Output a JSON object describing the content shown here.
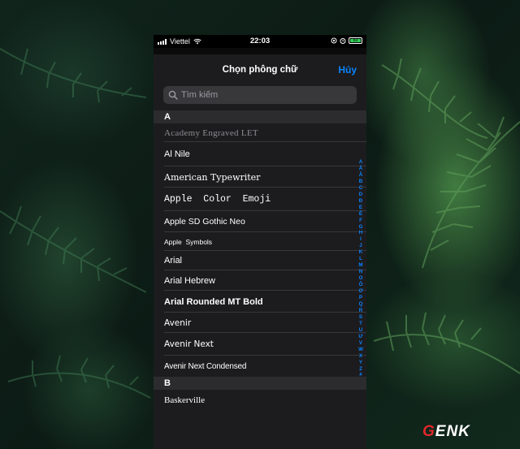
{
  "status_bar": {
    "carrier": "Viettel",
    "time": "22:03",
    "battery": "83"
  },
  "sheet": {
    "title": "Chọn phông chữ",
    "cancel_label": "Hủy",
    "search_placeholder": "Tìm kiếm",
    "sections": [
      {
        "letter": "A",
        "fonts": [
          "Academy Engraved LET",
          "Al Nile",
          "American Typewriter",
          "Apple  Color  Emoji",
          "Apple SD Gothic Neo",
          "Apple  Symbols",
          "Arial",
          "Arial Hebrew",
          "Arial Rounded MT Bold",
          "Avenir",
          "Avenir Next",
          "Avenir Next Condensed"
        ]
      },
      {
        "letter": "B",
        "fonts": [
          "Baskerville"
        ]
      }
    ]
  },
  "index_letters": [
    "A",
    "Ă",
    "Â",
    "B",
    "C",
    "D",
    "Đ",
    "E",
    "Ê",
    "F",
    "G",
    "H",
    "I",
    "J",
    "K",
    "L",
    "M",
    "N",
    "O",
    "Ô",
    "Ơ",
    "P",
    "Q",
    "R",
    "S",
    "T",
    "U",
    "Ư",
    "V",
    "W",
    "X",
    "Y",
    "Z",
    "#"
  ],
  "watermark": {
    "first": "G",
    "rest": "ENK"
  },
  "colors": {
    "accent": "#0a84ff",
    "sheet_bg": "#1c1c1e",
    "section_bg": "#2c2c2e",
    "watermark_red": "#e3272b"
  }
}
